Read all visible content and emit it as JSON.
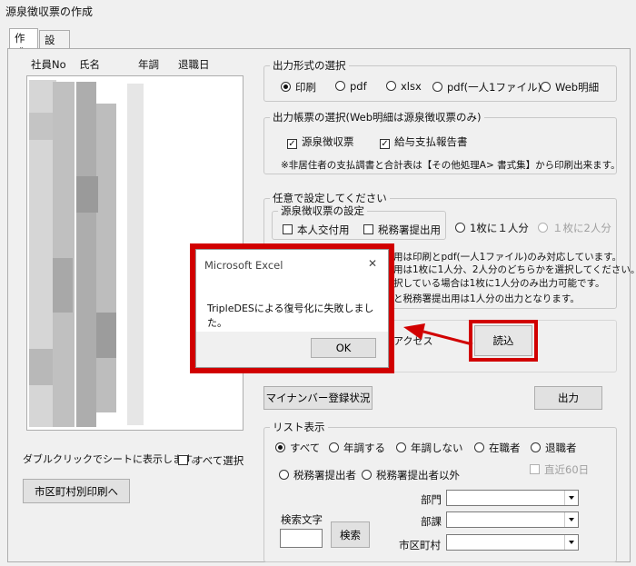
{
  "window": {
    "title": "源泉徴収票の作成"
  },
  "tabs": [
    {
      "label": "作成"
    },
    {
      "label": "設定"
    }
  ],
  "list": {
    "headers": [
      "社員No",
      "氏名",
      "年調",
      "退職日"
    ],
    "footer_hint": "ダブルクリックでシートに表示します。",
    "select_all": "すべて選択"
  },
  "buttons": {
    "city_print": "市区町村別印刷へ",
    "read": "読込",
    "mynumber": "マイナンバー登録状況",
    "output": "出力",
    "search": "検索"
  },
  "output_format": {
    "legend": "出力形式の選択",
    "options": [
      "印刷",
      "pdf",
      "xlsx",
      "pdf(一人1ファイル)",
      "Web明細"
    ],
    "selected": "印刷"
  },
  "report_type": {
    "legend": "出力帳票の選択(Web明細は源泉徴収票のみ)",
    "options": [
      "源泉徴収票",
      "給与支払報告書"
    ],
    "note": "※非居住者の支払調書と合計表は【その他処理A> 書式集】から印刷出来ます。"
  },
  "optional": {
    "legend": "任意で設定してください",
    "sub_legend": "源泉徴収票の設定",
    "checks": [
      "本人交付用",
      "税務署提出用"
    ],
    "per_sheet": [
      "1枚に１人分",
      "１枚に2人分"
    ],
    "notes": [
      "用は印刷とpdf(一人1ファイル)のみ対応しています。",
      "用は1枚に1人分、2人分のどちらかを選択してください。",
      "択している場合は1枚に1人分のみ出力可能です。",
      "と税務署提出用は1人分の出力となります。"
    ],
    "partial": "アクセス"
  },
  "list_display": {
    "legend": "リスト表示",
    "row1": [
      "すべて",
      "年調する",
      "年調しない",
      "在職者",
      "退職者"
    ],
    "row2": [
      "税務署提出者",
      "税務署提出者以外"
    ],
    "recent": "直近60日",
    "selected": "すべて"
  },
  "filters": {
    "dept": "部門",
    "section": "部課",
    "city": "市区町村",
    "search_label": "検索文字"
  },
  "dialog": {
    "title": "Microsoft Excel",
    "message": "TripleDESによる復号化に失敗しました。",
    "ok": "OK",
    "close": "✕"
  },
  "colors": {
    "highlight": "#d10000",
    "dialog_bg": "#ffffff"
  }
}
